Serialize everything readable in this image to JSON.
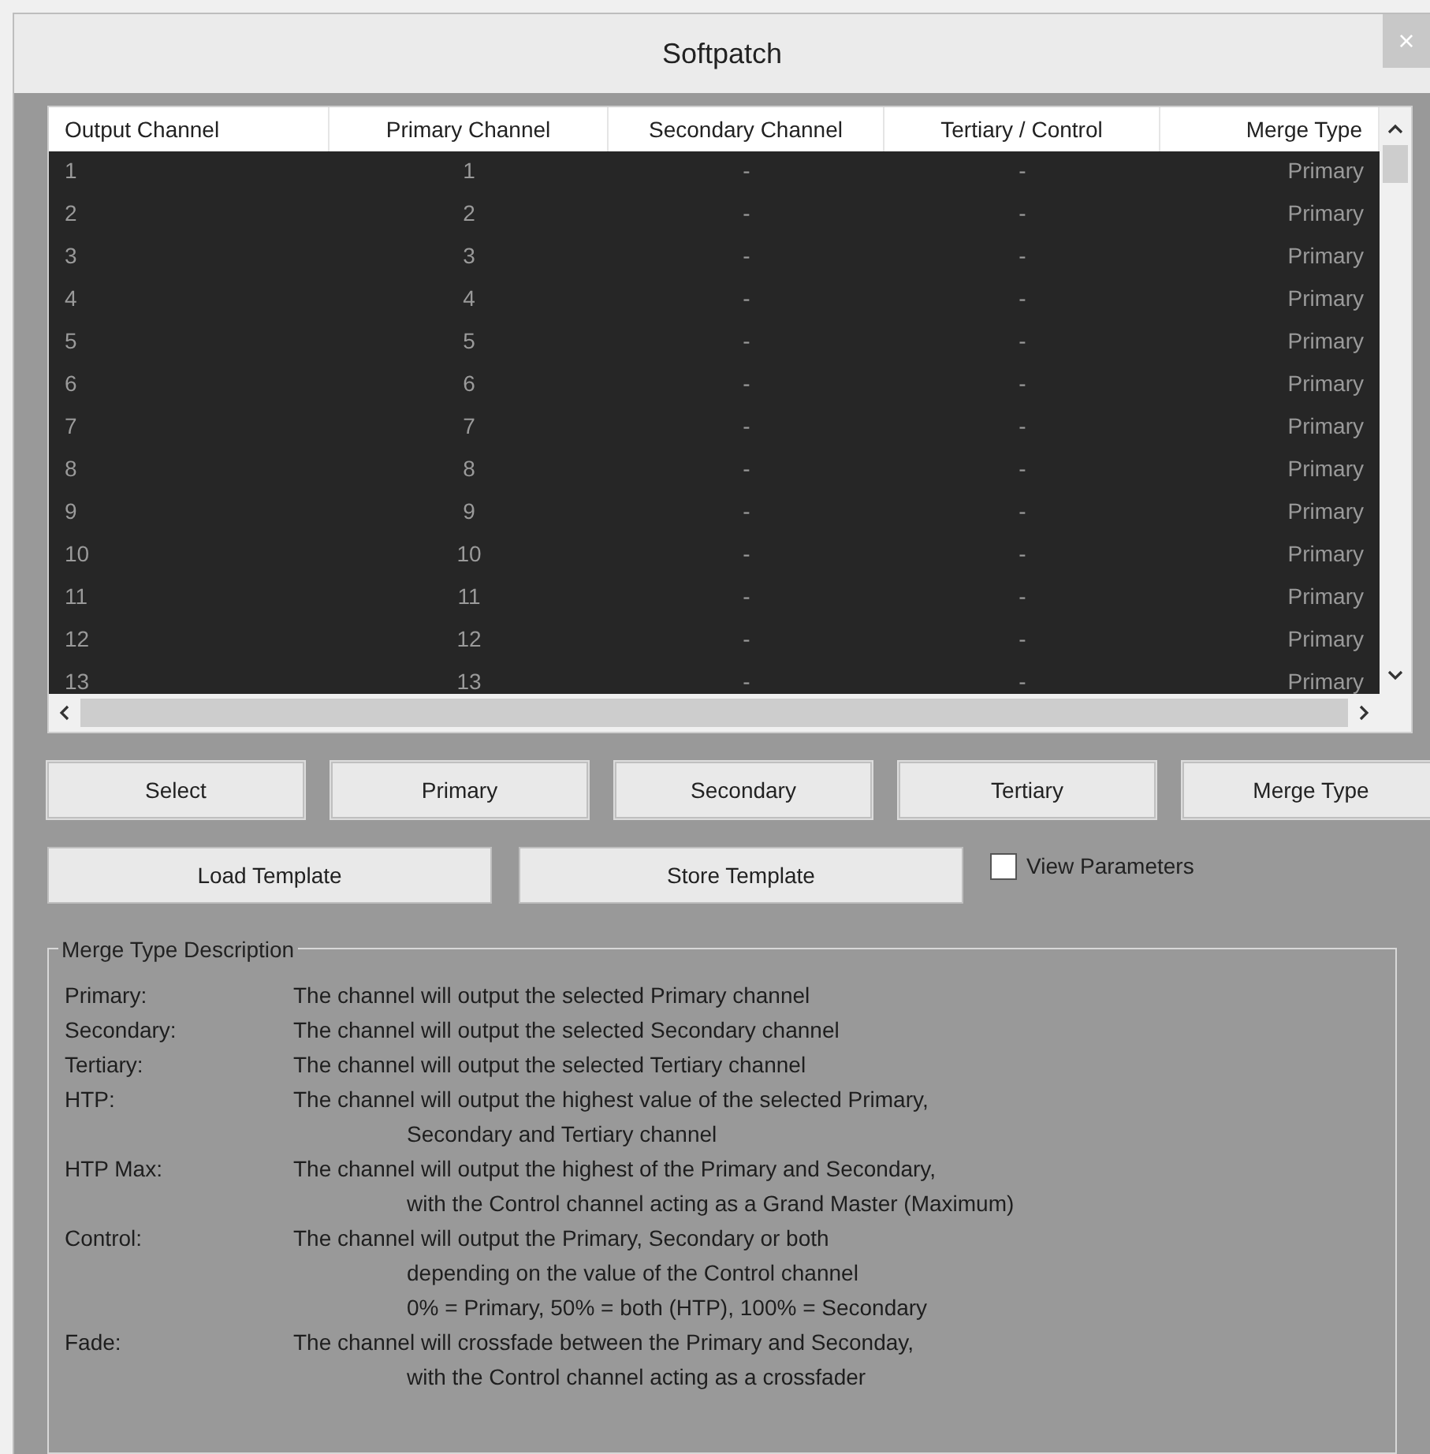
{
  "window": {
    "title": "Softpatch",
    "close": "×"
  },
  "table": {
    "columns": [
      {
        "label": "Output Channel"
      },
      {
        "label": "Primary Channel"
      },
      {
        "label": "Secondary Channel"
      },
      {
        "label": "Tertiary / Control"
      },
      {
        "label": "Merge Type"
      }
    ],
    "rows": [
      [
        "1",
        "1",
        "-",
        "-",
        "Primary"
      ],
      [
        "2",
        "2",
        "-",
        "-",
        "Primary"
      ],
      [
        "3",
        "3",
        "-",
        "-",
        "Primary"
      ],
      [
        "4",
        "4",
        "-",
        "-",
        "Primary"
      ],
      [
        "5",
        "5",
        "-",
        "-",
        "Primary"
      ],
      [
        "6",
        "6",
        "-",
        "-",
        "Primary"
      ],
      [
        "7",
        "7",
        "-",
        "-",
        "Primary"
      ],
      [
        "8",
        "8",
        "-",
        "-",
        "Primary"
      ],
      [
        "9",
        "9",
        "-",
        "-",
        "Primary"
      ],
      [
        "10",
        "10",
        "-",
        "-",
        "Primary"
      ],
      [
        "11",
        "11",
        "-",
        "-",
        "Primary"
      ],
      [
        "12",
        "12",
        "-",
        "-",
        "Primary"
      ],
      [
        "13",
        "13",
        "-",
        "-",
        "Primary"
      ]
    ]
  },
  "buttons": [
    "Select",
    "Primary",
    "Secondary",
    "Tertiary",
    "Merge Type"
  ],
  "template_buttons": [
    "Load Template",
    "Store Template"
  ],
  "view_parameters": {
    "label": "View Parameters",
    "checked": false
  },
  "description": {
    "title": "Merge Type Description",
    "items": [
      {
        "label": "Primary:",
        "lines": [
          "The channel will output the selected Primary channel"
        ]
      },
      {
        "label": "Secondary:",
        "lines": [
          "The channel will output the selected Secondary channel"
        ]
      },
      {
        "label": "Tertiary:",
        "lines": [
          "The channel will output the selected Tertiary channel"
        ]
      },
      {
        "label": "HTP:",
        "lines": [
          "The channel will output the highest value of the selected Primary,",
          "Secondary and Tertiary channel"
        ]
      },
      {
        "label": "HTP Max:",
        "lines": [
          "The channel will output the highest of the Primary and Secondary,",
          "with the Control channel acting as a Grand Master (Maximum)"
        ]
      },
      {
        "label": "Control:",
        "lines": [
          "The channel will output the Primary, Secondary or both",
          "depending on the value of the Control channel",
          "0% = Primary, 50% = both (HTP), 100% = Secondary"
        ]
      },
      {
        "label": "Fade:",
        "lines": [
          "The channel will crossfade between the Primary and Seconday,",
          "with the Control channel acting as a crossfader"
        ]
      }
    ]
  }
}
